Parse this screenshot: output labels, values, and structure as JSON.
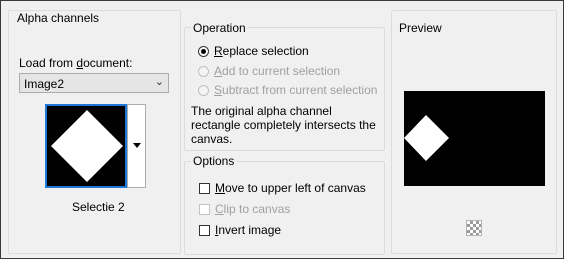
{
  "alpha_channels": {
    "title": "Alpha channels",
    "load_from_label_pre": "Load from ",
    "load_from_label_u": "d",
    "load_from_label_post": "ocument:",
    "document_value": "Image2",
    "channel_name": "Selectie 2"
  },
  "operation": {
    "title": "Operation",
    "options": [
      {
        "u": "R",
        "rest": "eplace selection",
        "selected": true,
        "enabled": true
      },
      {
        "u": "A",
        "rest": "dd to current selection",
        "selected": false,
        "enabled": false
      },
      {
        "u": "S",
        "rest": "ubtract from current selection",
        "selected": false,
        "enabled": false
      }
    ],
    "info_text": "The original alpha channel rectangle completely intersects the canvas."
  },
  "options": {
    "title": "Options",
    "items": [
      {
        "u": "M",
        "rest": "ove to upper left of canvas",
        "checked": false,
        "enabled": true
      },
      {
        "u": "C",
        "rest": "lip to canvas",
        "checked": false,
        "enabled": false
      },
      {
        "u": "I",
        "rest": "nvert image",
        "checked": false,
        "enabled": true
      }
    ]
  },
  "preview": {
    "title": "Preview"
  }
}
